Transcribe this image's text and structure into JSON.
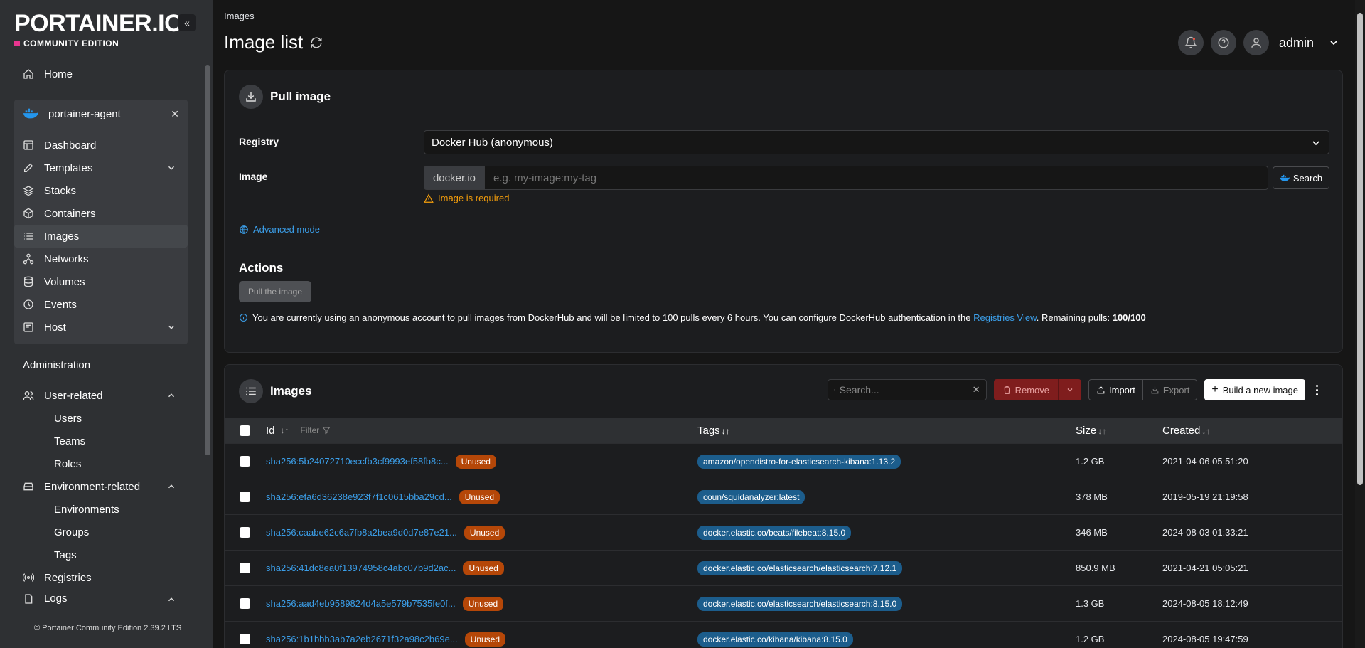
{
  "sidebar": {
    "logo": "PORTAINER.IO",
    "edition": "COMMUNITY EDITION",
    "home": "Home",
    "environment": "portainer-agent",
    "env_items": [
      {
        "label": "Dashboard",
        "icon": "dashboard-icon"
      },
      {
        "label": "Templates",
        "icon": "templates-icon"
      },
      {
        "label": "Stacks",
        "icon": "stacks-icon"
      },
      {
        "label": "Containers",
        "icon": "containers-icon"
      },
      {
        "label": "Images",
        "icon": "images-icon"
      },
      {
        "label": "Networks",
        "icon": "networks-icon"
      },
      {
        "label": "Volumes",
        "icon": "volumes-icon"
      },
      {
        "label": "Events",
        "icon": "events-icon"
      },
      {
        "label": "Host",
        "icon": "host-icon"
      }
    ],
    "administration": "Administration",
    "user_related": "User-related",
    "user_sub": [
      "Users",
      "Teams",
      "Roles"
    ],
    "environment_related": "Environment-related",
    "env_sub": [
      "Environments",
      "Groups",
      "Tags"
    ],
    "registries": "Registries",
    "logs": "Logs",
    "footer": "Portainer Community Edition 2.39.2 LTS"
  },
  "header": {
    "breadcrumb": "Images",
    "title": "Image list",
    "user": "admin"
  },
  "pull": {
    "title": "Pull image",
    "registry_label": "Registry",
    "registry_value": "Docker Hub (anonymous)",
    "image_label": "Image",
    "prefix": "docker.io",
    "placeholder": "e.g. my-image:my-tag",
    "search_label": "Search",
    "error": "Image is required",
    "advanced": "Advanced mode",
    "actions_title": "Actions",
    "pull_button": "Pull the image",
    "info_text": "You are currently using an anonymous account to pull images from DockerHub and will be limited to 100 pulls every 6 hours. You can configure DockerHub authentication in the",
    "info_link": "Registries View",
    "info_remaining_label": ". Remaining pulls:",
    "info_remaining": "100/100"
  },
  "images": {
    "title": "Images",
    "search_placeholder": "Search...",
    "remove": "Remove",
    "import": "Import",
    "export": "Export",
    "build": "Build a new image",
    "columns": {
      "id": "Id",
      "filter": "Filter",
      "tags": "Tags",
      "size": "Size",
      "created": "Created"
    },
    "rows": [
      {
        "id": "sha256:5b24072710eccfb3cf9993ef58fb8c...",
        "status": "Unused",
        "tag": "amazon/opendistro-for-elasticsearch-kibana:1.13.2",
        "size": "1.2 GB",
        "created": "2021-04-06 05:51:20"
      },
      {
        "id": "sha256:efa6d36238e923f7f1c0615bba29cd...",
        "status": "Unused",
        "tag": "coun/squidanalyzer:latest",
        "size": "378 MB",
        "created": "2019-05-19 21:19:58"
      },
      {
        "id": "sha256:caabe62c6a7fb8a2bea9d0d7e87e21...",
        "status": "Unused",
        "tag": "docker.elastic.co/beats/filebeat:8.15.0",
        "size": "346 MB",
        "created": "2024-08-03 01:33:21"
      },
      {
        "id": "sha256:41dc8ea0f13974958c4abc07b9d2ac...",
        "status": "Unused",
        "tag": "docker.elastic.co/elasticsearch/elasticsearch:7.12.1",
        "size": "850.9 MB",
        "created": "2021-04-21 05:05:21"
      },
      {
        "id": "sha256:aad4eb9589824d4a5e579b7535fe0f...",
        "status": "Unused",
        "tag": "docker.elastic.co/elasticsearch/elasticsearch:8.15.0",
        "size": "1.3 GB",
        "created": "2024-08-05 18:12:49"
      },
      {
        "id": "sha256:1b1bbb3ab7a2eb2671f32a98c2b69e...",
        "status": "Unused",
        "tag": "docker.elastic.co/kibana/kibana:8.15.0",
        "size": "1.2 GB",
        "created": "2024-08-05 19:47:59"
      }
    ]
  },
  "colors": {
    "accent": "#3b9ee8",
    "warning": "#f59e0b",
    "unused": "#b54708",
    "tag": "#1c5d8c",
    "danger": "#7f1d1d"
  }
}
